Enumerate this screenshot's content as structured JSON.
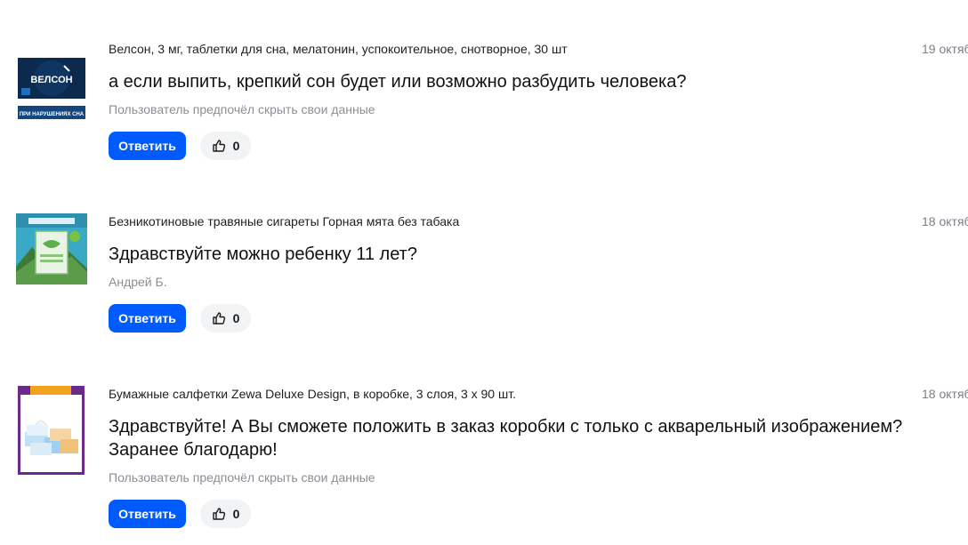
{
  "questions": [
    {
      "product": "Велсон, 3 мг, таблетки для сна, мелатонин, успокоительное, снотворное, 30 шт",
      "date": "19 октяб",
      "question": "а если выпить, крепкий сон будет или возможно разбудить человека?",
      "author": "Пользователь предпочёл скрыть свои данные",
      "reply_label": "Ответить",
      "likes": "0",
      "thumb": {
        "brand": "ВЕЛСОН",
        "caption": "ПРИ НАРУШЕНИЯХ СНА",
        "icon": "product-image-velson"
      }
    },
    {
      "product": "Безникотиновые травяные сигареты Горная мята без табака",
      "date": "18 октяб",
      "question": "Здравствуйте можно ребенку 11 лет?",
      "author": "Андрей Б.",
      "reply_label": "Ответить",
      "likes": "0",
      "thumb": {
        "icon": "product-image-herbal-cigarettes"
      }
    },
    {
      "product": "Бумажные салфетки Zewa Deluxe Design, в коробке, 3 слоя, 3 х 90 шт.",
      "date": "18 октяб",
      "question": "Здравствуйте! А Вы сможете положить в заказ коробки с только с акварельный изображением? Заранее благодарю!",
      "author": "Пользователь предпочёл скрыть свои данные",
      "reply_label": "Ответить",
      "likes": "0",
      "thumb": {
        "icon": "product-image-zewa-napkins"
      }
    }
  ],
  "colors": {
    "accent": "#005bff",
    "muted_text": "#8a8f96",
    "like_bg": "#f2f3f5"
  }
}
